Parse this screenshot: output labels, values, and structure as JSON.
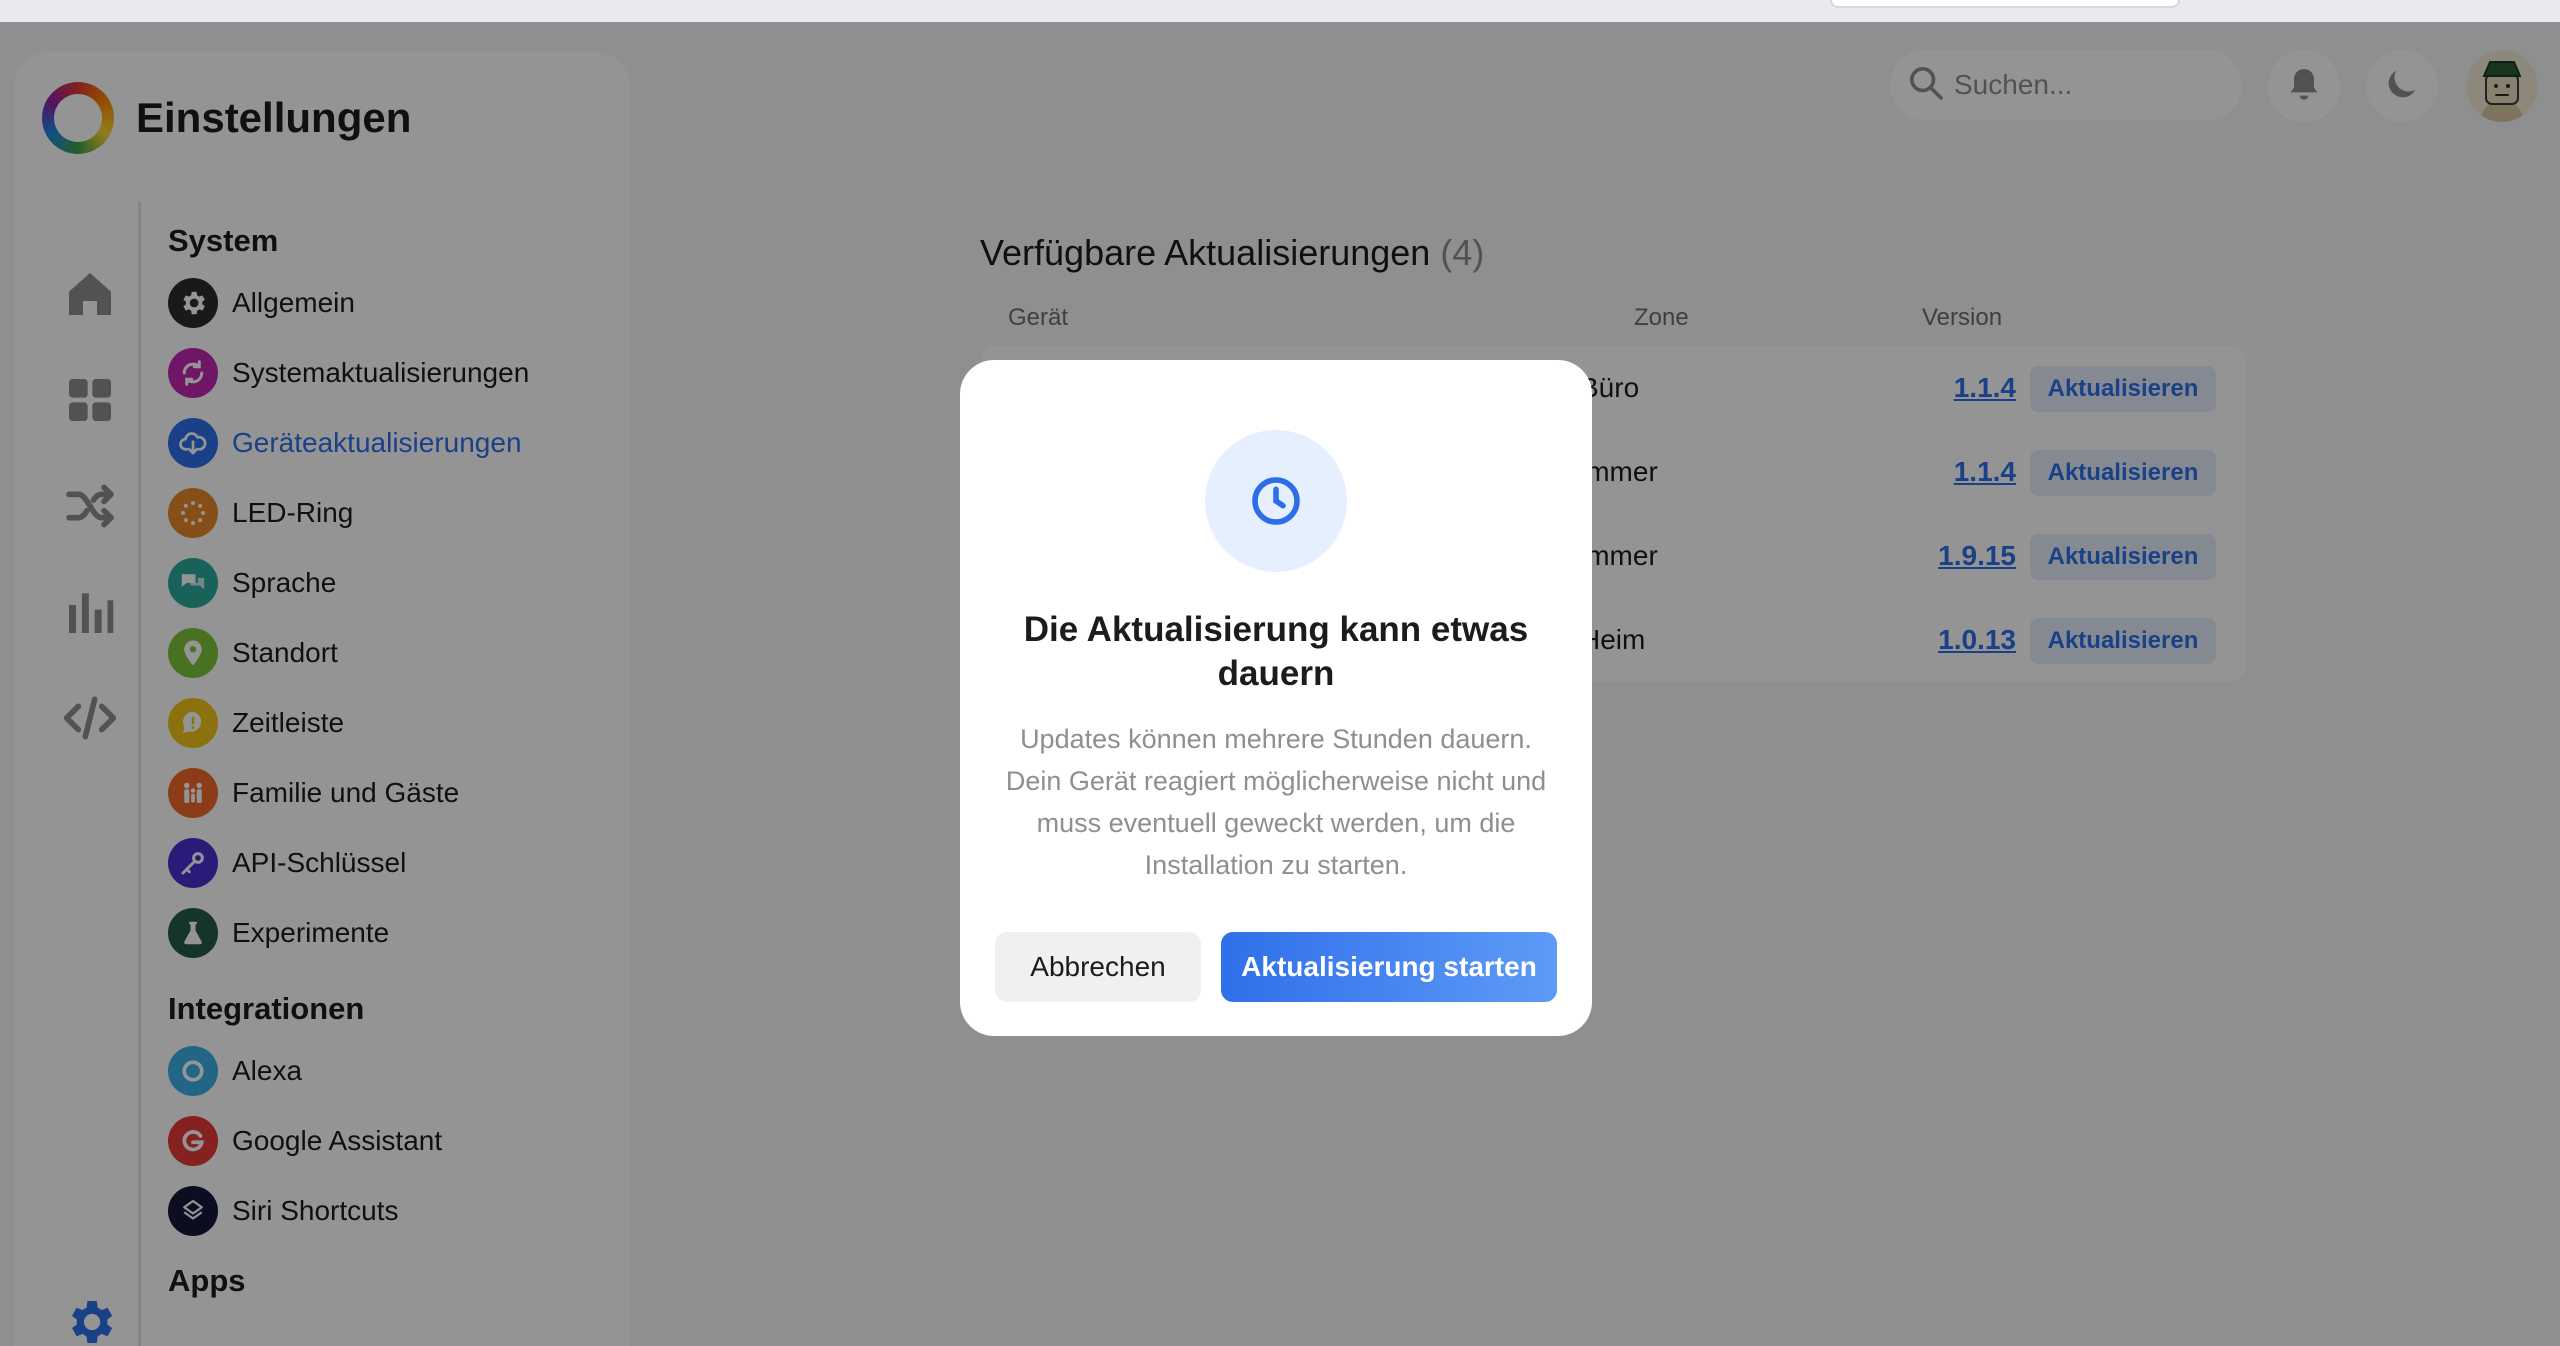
{
  "app": {
    "title": "Einstellungen"
  },
  "rail": {
    "items": [
      {
        "icon": "home-icon"
      },
      {
        "icon": "grid-icon"
      },
      {
        "icon": "shuffle-icon"
      },
      {
        "icon": "bar-chart-icon"
      },
      {
        "icon": "code-icon"
      }
    ],
    "bottom_icon": "gear-icon"
  },
  "menu": {
    "system_title": "System",
    "system_items": [
      {
        "label": "Allgemein",
        "icon": "gear-icon",
        "color": "#2b2b2e"
      },
      {
        "label": "Systemaktualisierungen",
        "icon": "refresh-icon",
        "color": "#c027b0"
      },
      {
        "label": "Geräteaktualisierungen",
        "icon": "cloud-download-icon",
        "color": "#2d6ee8",
        "active": true
      },
      {
        "label": "LED-Ring",
        "icon": "led-ring-icon",
        "color": "#e8892a"
      },
      {
        "label": "Sprache",
        "icon": "chat-icon",
        "color": "#2ba99b"
      },
      {
        "label": "Standort",
        "icon": "location-pin-icon",
        "color": "#7cc33a"
      },
      {
        "label": "Zeitleiste",
        "icon": "timeline-icon",
        "color": "#f0c419"
      },
      {
        "label": "Familie und Gäste",
        "icon": "family-icon",
        "color": "#f06a2a"
      },
      {
        "label": "API-Schlüssel",
        "icon": "key-icon",
        "color": "#4b2fd0"
      },
      {
        "label": "Experimente",
        "icon": "flask-icon",
        "color": "#245c46"
      }
    ],
    "integrations_title": "Integrationen",
    "integration_items": [
      {
        "label": "Alexa",
        "icon": "alexa-icon",
        "color": "#3bb0e6"
      },
      {
        "label": "Google Assistant",
        "icon": "google-icon",
        "color": "#e53935"
      },
      {
        "label": "Siri Shortcuts",
        "icon": "siri-icon",
        "color": "#15173a"
      }
    ],
    "apps_title": "Apps"
  },
  "header": {
    "search_placeholder": "Suchen...",
    "bell_icon": "bell-icon",
    "theme_icon": "moon-icon",
    "avatar_icon": "avatar-icon"
  },
  "updates": {
    "heading": "Verfügbare Aktualisierungen",
    "count": "(4)",
    "columns": {
      "device": "Gerät",
      "zone": "Zone",
      "version": "Version"
    },
    "rows": [
      {
        "zone": "Büro",
        "version": "1.1.4",
        "action": "Aktualisieren"
      },
      {
        "zone": "immer",
        "version": "1.1.4",
        "action": "Aktualisieren"
      },
      {
        "zone": "immer",
        "version": "1.9.15",
        "action": "Aktualisieren"
      },
      {
        "zone": "Heim",
        "version": "1.0.13",
        "action": "Aktualisieren"
      }
    ]
  },
  "modal": {
    "icon": "clock-icon",
    "title": "Die Aktualisierung kann etwas dauern",
    "body": "Updates können mehrere Stunden dauern. Dein Gerät reagiert möglicherweise nicht und muss eventuell geweckt werden, um die Installation zu starten.",
    "cancel_label": "Abbrechen",
    "start_label": "Aktualisierung starten"
  },
  "colors": {
    "accent": "#2d6ee8",
    "overlay": "rgba(0,0,0,0.42)"
  }
}
